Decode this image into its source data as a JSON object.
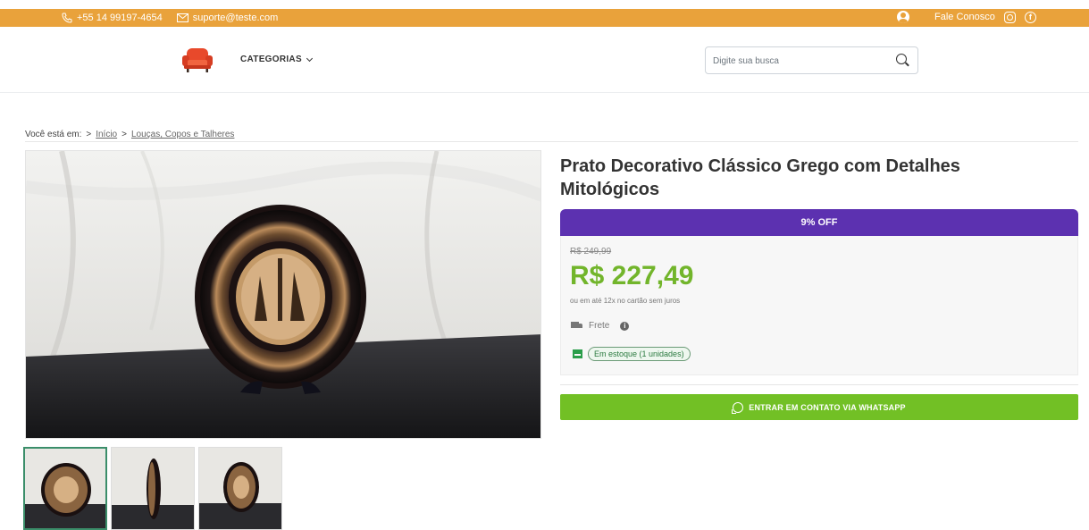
{
  "topbar": {
    "phone": "+55 14 99197-4654",
    "email": "suporte@teste.com",
    "contact_label": "Fale Conosco"
  },
  "header": {
    "categories_label": "CATEGORIAS",
    "search_placeholder": "Digite sua busca"
  },
  "breadcrumb": {
    "prefix": "Você está em:",
    "sep": ">",
    "items": [
      "Início",
      "Louças, Copos e Talheres"
    ]
  },
  "product": {
    "title": "Prato Decorativo Clássico Grego com Detalhes Mitológicos",
    "discount": "9% OFF",
    "old_price": "R$ 249,99",
    "price": "R$ 227,49",
    "installments": "ou em até 12x no cartão sem juros",
    "shipping_label": "Frete",
    "stock": "Em estoque (1 unidades)",
    "whatsapp_label": "ENTRAR EM CONTATO VIA WHATSAPP"
  },
  "colors": {
    "topbar": "#e9a23b",
    "discount_bar": "#5c31b0",
    "price": "#72b52b",
    "whatsapp_button": "#72c025"
  }
}
